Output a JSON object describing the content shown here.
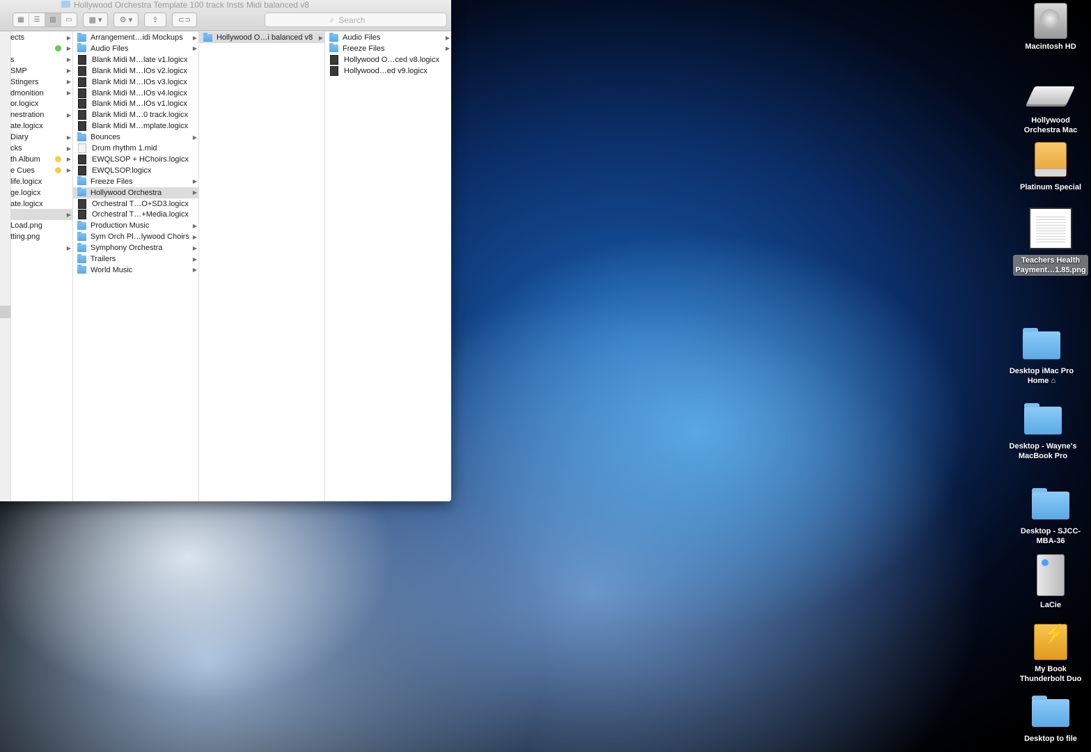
{
  "window": {
    "title": "Hollywood Orchestra Template 100 track Insts Midi balanced v8",
    "search_placeholder": "Search"
  },
  "column1": [
    {
      "label": "ects",
      "arrow": true
    },
    {
      "label": "",
      "arrow": true,
      "tag": "#5fcf4e"
    },
    {
      "label": "s",
      "arrow": true
    },
    {
      "label": "SMP",
      "arrow": true
    },
    {
      "label": " Stingers",
      "arrow": true
    },
    {
      "label": "dmonition",
      "arrow": true
    },
    {
      "label": "or.logicx",
      "arrow": false
    },
    {
      "label": "nestration",
      "arrow": true
    },
    {
      "label": "ate.logicx",
      "arrow": false
    },
    {
      "label": "Diary",
      "arrow": true
    },
    {
      "label": "cks",
      "arrow": true
    },
    {
      "label": "th Album",
      "arrow": true,
      "tag": "#f2cf45"
    },
    {
      "label": "e Cues",
      "arrow": true,
      "tag": "#f2cf45"
    },
    {
      "label": "life.logicx",
      "arrow": false
    },
    {
      "label": "ge.logicx",
      "arrow": false
    },
    {
      "label": "ate.logicx",
      "arrow": false
    },
    {
      "label": "",
      "arrow": true,
      "selected": true
    },
    {
      "label": "Load.png",
      "arrow": false
    },
    {
      "label": "tting.png",
      "arrow": false
    },
    {
      "label": "",
      "arrow": true
    }
  ],
  "column2": [
    {
      "label": "Arrangement…idi Mockups",
      "type": "folder",
      "arrow": true
    },
    {
      "label": "Audio Files",
      "type": "folder",
      "arrow": true
    },
    {
      "label": "Blank Midi M…late v1.logicx",
      "type": "logic",
      "arrow": false
    },
    {
      "label": "Blank Midi M…IOs v2.logicx",
      "type": "logic",
      "arrow": false
    },
    {
      "label": "Blank Midi M…IOs v3.logicx",
      "type": "logic",
      "arrow": false
    },
    {
      "label": "Blank Midi M…IOs v4.logicx",
      "type": "logic",
      "arrow": false
    },
    {
      "label": "Blank Midi M…IOs v1.logicx",
      "type": "logic",
      "arrow": false
    },
    {
      "label": "Blank Midi M…0 track.logicx",
      "type": "logic",
      "arrow": false
    },
    {
      "label": "Blank Midi M…mplate.logicx",
      "type": "logic",
      "arrow": false
    },
    {
      "label": "Bounces",
      "type": "folder",
      "arrow": true
    },
    {
      "label": "Drum rhythm 1.mid",
      "type": "mid",
      "arrow": false
    },
    {
      "label": "EWQLSOP + HChoirs.logicx",
      "type": "logic",
      "arrow": false
    },
    {
      "label": "EWQLSOP.logicx",
      "type": "logic",
      "arrow": false
    },
    {
      "label": "Freeze Files",
      "type": "folder",
      "arrow": true
    },
    {
      "label": "Hollywood Orchestra",
      "type": "folder",
      "arrow": true,
      "selected": true
    },
    {
      "label": "Orchestral T…O+SD3.logicx",
      "type": "logic",
      "arrow": false
    },
    {
      "label": "Orchestral T…+Media.logicx",
      "type": "logic",
      "arrow": false
    },
    {
      "label": "Production Music",
      "type": "folder",
      "arrow": true
    },
    {
      "label": "Sym Orch Pl…lywood Choirs",
      "type": "folder",
      "arrow": true
    },
    {
      "label": "Symphony Orchestra",
      "type": "folder",
      "arrow": true
    },
    {
      "label": "Trailers",
      "type": "folder",
      "arrow": true
    },
    {
      "label": "World Music",
      "type": "folder",
      "arrow": true
    }
  ],
  "column3": [
    {
      "label": "Hollywood O…i balanced v8",
      "type": "folder",
      "arrow": true,
      "selected": true
    }
  ],
  "column4": [
    {
      "label": "Audio Files",
      "type": "folder",
      "arrow": true
    },
    {
      "label": "Freeze Files",
      "type": "folder",
      "arrow": true
    },
    {
      "label": "Hollywood O…ced v8.logicx",
      "type": "logic",
      "arrow": false
    },
    {
      "label": "Hollywood…ed v9.logicx",
      "type": "logic",
      "arrow": false
    }
  ],
  "desktop": {
    "macintosh_hd": "Macintosh HD",
    "hollywood_mac": "Hollywood\nOrchestra Mac",
    "platinum": "Platinum Special",
    "teachers_1": "Teachers Health",
    "teachers_2": "Payment…1.85.png",
    "imac_home": "Desktop iMac Pro\nHome ⌂",
    "waynes_mbp": "Desktop - Wayne's\nMacBook Pro",
    "sjcc": "Desktop - SJCC-\nMBA-36",
    "lacie": "LaCie",
    "mybook": "My Book\nThunderbolt Duo",
    "to_file": "Desktop to file"
  }
}
